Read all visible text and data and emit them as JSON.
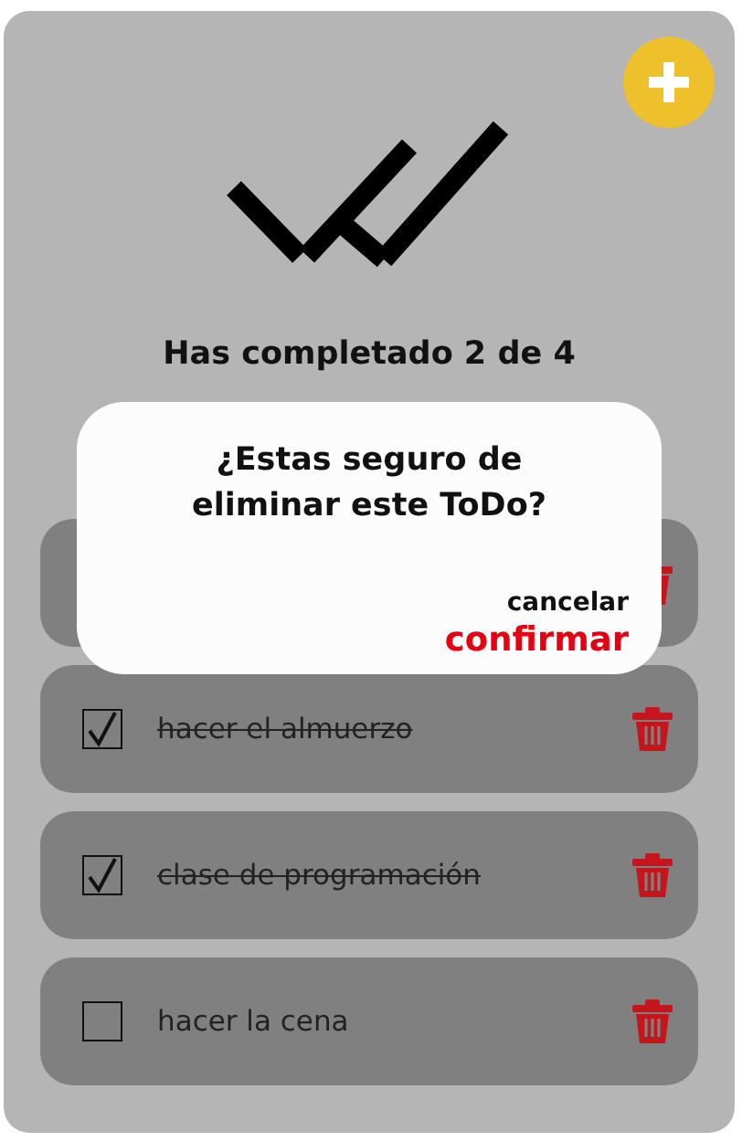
{
  "header": {
    "title": "Has completado 2 de 4"
  },
  "todos": [
    {
      "kind": "covered"
    },
    {
      "kind": "item",
      "text": "hacer el almuerzo",
      "completed": true
    },
    {
      "kind": "item",
      "text": "clase de programación",
      "completed": true
    },
    {
      "kind": "item",
      "text": "hacer la cena",
      "completed": false
    }
  ],
  "dialog": {
    "question": "¿Estas seguro de eliminar este ToDo?",
    "cancel": "cancelar",
    "confirm": "confirmar"
  }
}
